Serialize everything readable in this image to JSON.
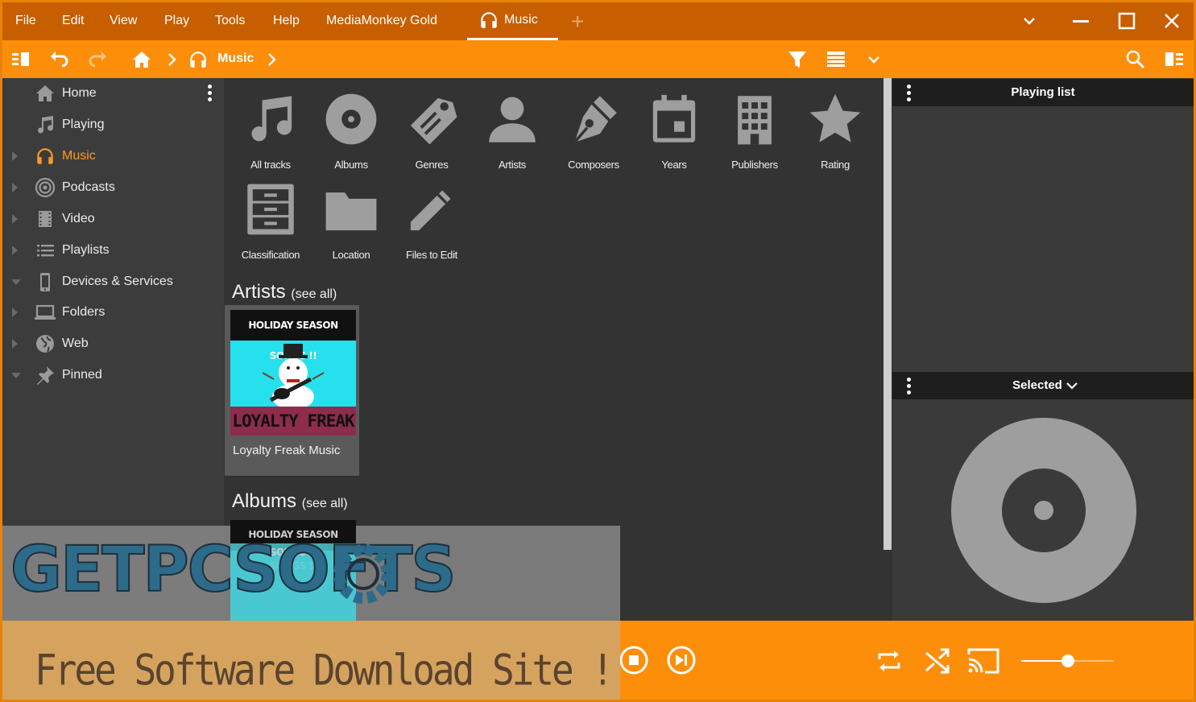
{
  "menubar": {
    "items": [
      "File",
      "Edit",
      "View",
      "Play",
      "Tools",
      "Help",
      "MediaMonkey Gold"
    ],
    "active_tab": "Music"
  },
  "toolbar": {
    "breadcrumb": "Music"
  },
  "leftnav": {
    "items": [
      {
        "label": "Home",
        "icon": "home-icon",
        "arrow": "none"
      },
      {
        "label": "Playing",
        "icon": "music-note-icon",
        "arrow": "none"
      },
      {
        "label": "Music",
        "icon": "headphones-icon",
        "arrow": "right"
      },
      {
        "label": "Podcasts",
        "icon": "podcast-icon",
        "arrow": "right"
      },
      {
        "label": "Video",
        "icon": "film-icon",
        "arrow": "right"
      },
      {
        "label": "Playlists",
        "icon": "list-icon",
        "arrow": "right"
      },
      {
        "label": "Devices & Services",
        "icon": "phone-icon",
        "arrow": "down"
      },
      {
        "label": "Folders",
        "icon": "laptop-icon",
        "arrow": "right"
      },
      {
        "label": "Web",
        "icon": "globe-icon",
        "arrow": "right"
      },
      {
        "label": "Pinned",
        "icon": "pin-icon",
        "arrow": "down"
      }
    ],
    "active": "Music"
  },
  "main": {
    "tiles": [
      {
        "label": "All tracks",
        "icon": "music-note-icon"
      },
      {
        "label": "Albums",
        "icon": "disc-icon"
      },
      {
        "label": "Genres",
        "icon": "tag-icon"
      },
      {
        "label": "Artists",
        "icon": "person-icon"
      },
      {
        "label": "Composers",
        "icon": "pen-nib-icon"
      },
      {
        "label": "Years",
        "icon": "calendar-icon"
      },
      {
        "label": "Publishers",
        "icon": "building-icon"
      },
      {
        "label": "Rating",
        "icon": "star-icon"
      },
      {
        "label": "Classification",
        "icon": "cabinet-icon"
      },
      {
        "label": "Location",
        "icon": "folder-icon"
      },
      {
        "label": "Files to Edit",
        "icon": "pencil-icon"
      }
    ],
    "artists_title": "Artists",
    "artists_see_all": "(see all)",
    "albums_title": "Albums",
    "albums_see_all": "(see all)",
    "artist_card": {
      "name": "Loyalty Freak Music",
      "cover_header": "HOLIDAY SEASON SONGS !!",
      "cover_footer": "LOYALTY FREAK MUSIC"
    },
    "album_card": {
      "cover_header": "HOLIDAY SEASON SONGS !!"
    }
  },
  "right": {
    "playing_list": "Playing list",
    "selected": "Selected"
  },
  "watermark": {
    "logo": "GETPCSOFTS",
    "tagline": "Free Software Download Site !"
  },
  "player": {
    "volume": 0.5
  }
}
